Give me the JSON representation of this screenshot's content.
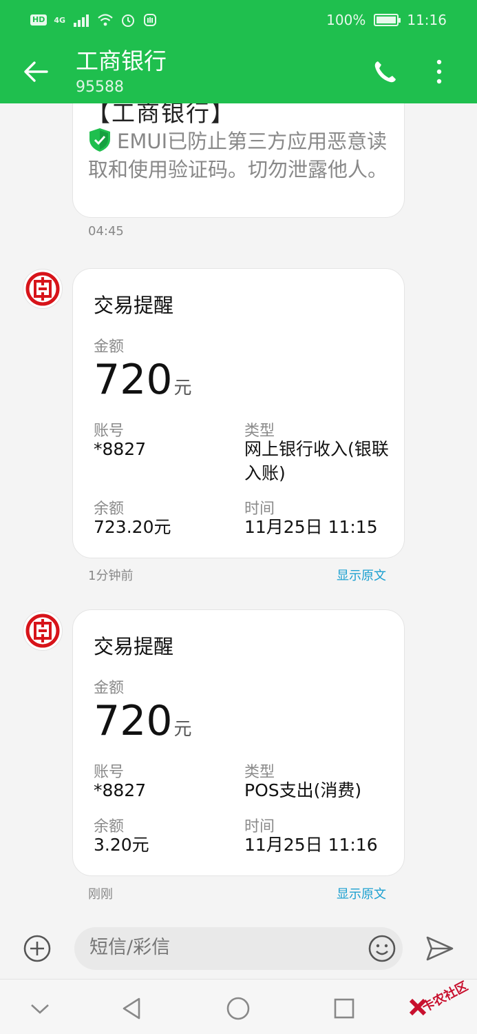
{
  "status_bar": {
    "hd_badge": "HD",
    "network": "4G",
    "battery": "100%",
    "time": "11:16"
  },
  "header": {
    "title": "工商银行",
    "number": "95588",
    "bg_color": "#1fbf4e"
  },
  "messages": {
    "top": {
      "cutoff_text": "【工商银行】",
      "text": "EMUI已防止第三方应用恶意读取和使用验证码。切勿泄露他人。",
      "time": "04:45"
    },
    "cards": [
      {
        "title": "交易提醒",
        "amount_label": "金额",
        "amount": "720",
        "amount_unit": "元",
        "account_label": "账号",
        "account": "*8827",
        "type_label": "类型",
        "type": "网上银行收入(银联入账)",
        "balance_label": "余额",
        "balance": "723.20元",
        "time_label": "时间",
        "datetime": "11月25日 11:15",
        "time_ago": "1分钟前",
        "show_original": "显示原文"
      },
      {
        "title": "交易提醒",
        "amount_label": "金额",
        "amount": "720",
        "amount_unit": "元",
        "account_label": "账号",
        "account": "*8827",
        "type_label": "类型",
        "type": "POS支出(消费)",
        "balance_label": "余额",
        "balance": "3.20元",
        "time_label": "时间",
        "datetime": "11月25日 11:16",
        "time_ago": "刚刚",
        "show_original": "显示原文"
      }
    ]
  },
  "composer": {
    "placeholder": "短信/彩信"
  },
  "watermark": {
    "text": "卡农社区"
  },
  "accent_link_color": "#1a9fd0",
  "bank_logo_color": "#d7141a"
}
